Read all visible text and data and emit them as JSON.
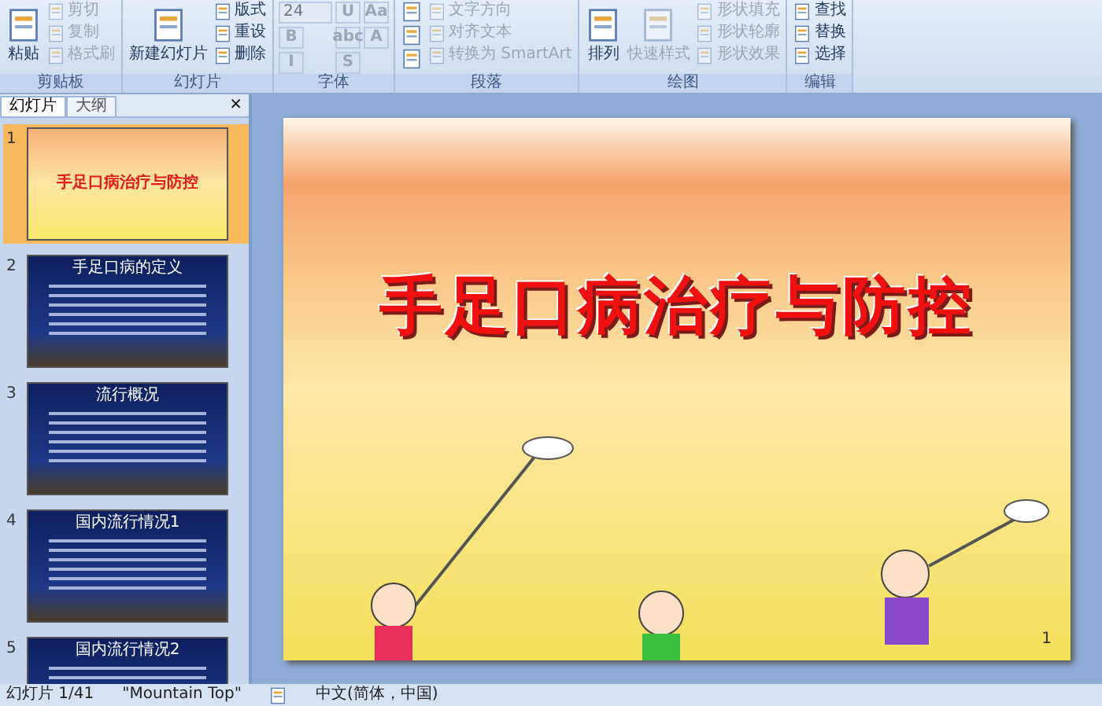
{
  "ribbon": {
    "groups": [
      {
        "label": "剪贴板",
        "buttons": [
          {
            "kind": "large",
            "label": "粘贴",
            "disabled": false
          },
          {
            "kind": "small",
            "label": "剪切",
            "disabled": true
          },
          {
            "kind": "small",
            "label": "复制",
            "disabled": true
          },
          {
            "kind": "small",
            "label": "格式刷",
            "disabled": true
          }
        ]
      },
      {
        "label": "幻灯片",
        "buttons": [
          {
            "kind": "large",
            "label": "新建幻灯片",
            "disabled": false
          },
          {
            "kind": "small",
            "label": "版式",
            "disabled": false
          },
          {
            "kind": "small",
            "label": "重设",
            "disabled": false
          },
          {
            "kind": "small",
            "label": "删除",
            "disabled": false
          }
        ]
      },
      {
        "label": "字体",
        "buttons": [
          {
            "kind": "field",
            "label": "24",
            "disabled": true
          },
          {
            "kind": "glyph",
            "label": "B",
            "disabled": true
          },
          {
            "kind": "glyph",
            "label": "I",
            "disabled": true
          },
          {
            "kind": "glyph",
            "label": "U",
            "disabled": true
          },
          {
            "kind": "glyph",
            "label": "abc",
            "disabled": true
          },
          {
            "kind": "glyph",
            "label": "S",
            "disabled": true
          },
          {
            "kind": "glyph",
            "label": "Aa",
            "disabled": true
          },
          {
            "kind": "glyph",
            "label": "A",
            "disabled": true
          }
        ]
      },
      {
        "label": "段落",
        "buttons": [
          {
            "kind": "icon",
            "disabled": false
          },
          {
            "kind": "icon",
            "disabled": false
          },
          {
            "kind": "icon",
            "disabled": false
          },
          {
            "kind": "small",
            "label": "文字方向",
            "disabled": true
          },
          {
            "kind": "small",
            "label": "对齐文本",
            "disabled": true
          },
          {
            "kind": "small",
            "label": "转换为 SmartArt",
            "disabled": true
          }
        ]
      },
      {
        "label": "绘图",
        "buttons": [
          {
            "kind": "large",
            "label": "排列",
            "disabled": false
          },
          {
            "kind": "large",
            "label": "快速样式",
            "disabled": true
          },
          {
            "kind": "small",
            "label": "形状填充",
            "disabled": true
          },
          {
            "kind": "small",
            "label": "形状轮廓",
            "disabled": true
          },
          {
            "kind": "small",
            "label": "形状效果",
            "disabled": true
          }
        ]
      },
      {
        "label": "编辑",
        "buttons": [
          {
            "kind": "small",
            "label": "查找",
            "disabled": false
          },
          {
            "kind": "small",
            "label": "替换",
            "disabled": false
          },
          {
            "kind": "small",
            "label": "选择",
            "disabled": false
          }
        ]
      }
    ]
  },
  "panel": {
    "tabs": [
      {
        "label": "幻灯片",
        "selected": true
      },
      {
        "label": "大纲",
        "selected": false
      }
    ],
    "close": "×",
    "slides": [
      {
        "number": "1",
        "title": "手足口病治疗与防控",
        "kind": "cover",
        "selected": true
      },
      {
        "number": "2",
        "title": "手足口病的定义",
        "kind": "content",
        "selected": false
      },
      {
        "number": "3",
        "title": "流行概况",
        "kind": "content",
        "selected": false
      },
      {
        "number": "4",
        "title": "国内流行情况1",
        "kind": "content",
        "selected": false
      },
      {
        "number": "5",
        "title": "国内流行情况2",
        "kind": "content",
        "selected": false
      }
    ]
  },
  "slide": {
    "title": "手足口病治疗与防控",
    "number": "1"
  },
  "status_bar": {
    "position": "幻灯片 1/41",
    "theme": "\"Mountain Top\"",
    "language": "中文(简体，中国)"
  }
}
